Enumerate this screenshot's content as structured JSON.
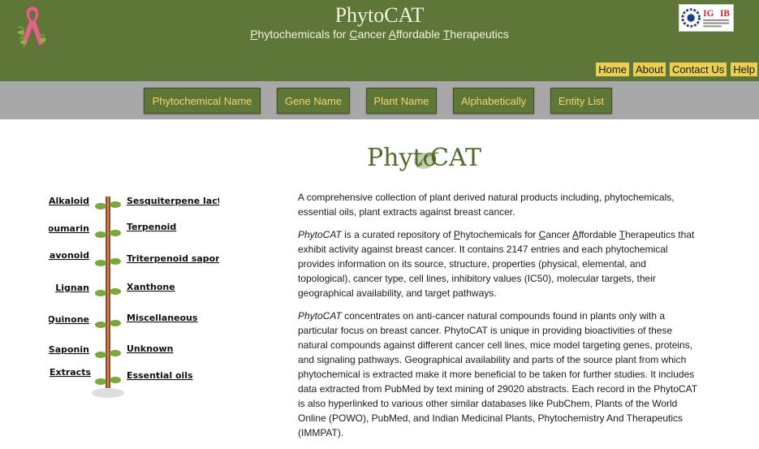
{
  "header": {
    "title": "PhytoCAT",
    "subtitle": {
      "p_initial": "P",
      "p_rest": "hytochemicals for ",
      "c_initial": "C",
      "c_rest": "ancer ",
      "a_initial": "A",
      "a_rest": "ffordable ",
      "t_initial": "T",
      "t_rest": "herapeutics"
    },
    "institute_logo_text": "IG",
    "institute_logo_text2": "IB"
  },
  "topnav": [
    "Home",
    "About",
    "Contact Us",
    "Help"
  ],
  "category_buttons": [
    "Phytochemical Name",
    "Gene Name",
    "Plant Name",
    "Alphabetically",
    "Entity List"
  ],
  "brand_logo": {
    "text_phyto": "Phyto",
    "text_cat": "CAT"
  },
  "tree": {
    "left": [
      "Alkaloid",
      "Coumarin",
      "Flavonoid",
      "Lignan",
      "Quinone",
      "Saponin",
      "Extracts"
    ],
    "right": [
      "Sesquiterpene lactone",
      "Terpenoid",
      "Triterpenoid saponin",
      "Xanthone",
      "Miscellaneous",
      "Unknown",
      "Essential oils"
    ]
  },
  "description": {
    "p1": "A comprehensive collection of plant derived natural products including, phytochemicals, essential oils, plant extracts against breast cancer.",
    "p2_name": "PhytoCAT",
    "p2_a": " is a curated repository of ",
    "p2_p": "P",
    "p2_p_rest": "hytochemicals for ",
    "p2_c": "C",
    "p2_c_rest": "ancer ",
    "p2_aa": "A",
    "p2_aa_rest": "ffordable ",
    "p2_t": "T",
    "p2_t_rest": "herapeutics",
    "p2_b": " that exhibit activity against breast cancer. It contains 2147 entries and each phytochemical provides information on its source, structure, properties (physical, elemental, and topological), cancer type, cell lines, inhibitory values (IC50), molecular targets, their geographical availability, and target pathways.",
    "p3_name": "PhytoCAT",
    "p3_b": " concentrates on anti-cancer natural compounds found in plants only with a particular focus on breast cancer. PhytoCAT is unique in providing bioactivities of these natural compounds against different cancer cell lines, mice model targeting genes, proteins, and signaling pathways. Geographical availability and parts of the source plant from which phytochemical is extracted make it more beneficial to be taken for further studies. It includes data extracted from PubMed by text mining of 29020 abstracts. Each record in the PhytoCAT is also hyperlinked to various other similar databases like PubChem, Plants of the World Online (POWO), PubMed, and Indian Medicinal Plants, Phytochemistry And Therapeutics (IMMPAT)."
  },
  "colors": {
    "header_green": "#5e7738",
    "nav_yellow": "#e9cf53",
    "button_text": "#f2d76a",
    "catbar_gray": "#a8a8a8"
  }
}
